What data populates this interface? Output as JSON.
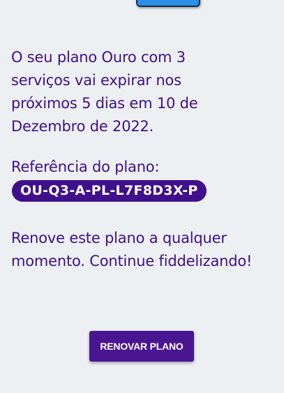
{
  "header": {
    "icon": "plan-icon"
  },
  "notice": {
    "message": "O seu plano Ouro com 3 serviços vai expirar nos próximos 5 dias em 10 de Dezembro de 2022.",
    "reference_label": "Referência do plano:",
    "reference_code": "OU-Q3-A-PL-L7F8D3X-P",
    "renew_message": "Renove este plano a qualquer momento. Continue fiddelizando!"
  },
  "actions": {
    "renew_button_label": "RENOVAR PLANO"
  },
  "colors": {
    "background": "#edf0f2",
    "text": "#3f0f8c",
    "badge": "#3f0f8c",
    "button": "#4a1591",
    "icon_blue": "#2a8fe6"
  }
}
